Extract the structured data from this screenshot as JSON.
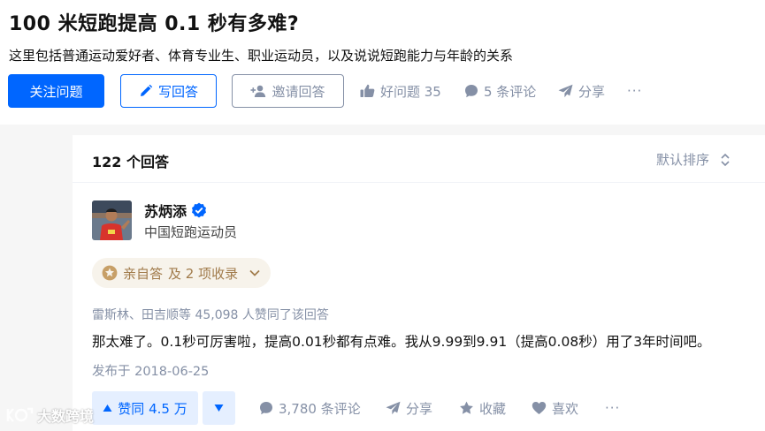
{
  "question": {
    "title": "100 米短跑提高 0.1 秒有多难?",
    "description": "这里包括普通运动爱好者、体育专业生、职业运动员，以及说说短跑能力与年龄的关系",
    "buttons": {
      "follow": "关注问题",
      "write": "写回答",
      "invite": "邀请回答"
    },
    "actions": {
      "good_question": "好问题 35",
      "comments": "5 条评论",
      "share": "分享",
      "more": "···"
    }
  },
  "answers": {
    "count_label": "122 个回答",
    "sort_label": "默认排序"
  },
  "answer": {
    "author_name": "苏炳添",
    "author_desc": "中国短跑运动员",
    "badge_main": "亲自答",
    "badge_extra": "及 2 项收录",
    "voters": "雷斯林、田吉顺等 45,098 人赞同了该回答",
    "content": "那太难了。0.1秒可厉害啦，提高0.01秒都有点难。我从9.99到9.91（提高0.08秒）用了3年时间吧。",
    "published": "发布于 2018-06-25",
    "vote_up": "赞同 4.5 万",
    "comments": "3,780 条评论",
    "share": "分享",
    "favorite": "收藏",
    "like": "喜欢",
    "more": "···"
  },
  "watermark": "大数跨境",
  "colors": {
    "primary": "#0066ff",
    "muted": "#8590a6",
    "badge_bg": "#f7f3eb",
    "badge_text": "#a17b4b",
    "vote_bg": "#e5efff"
  }
}
